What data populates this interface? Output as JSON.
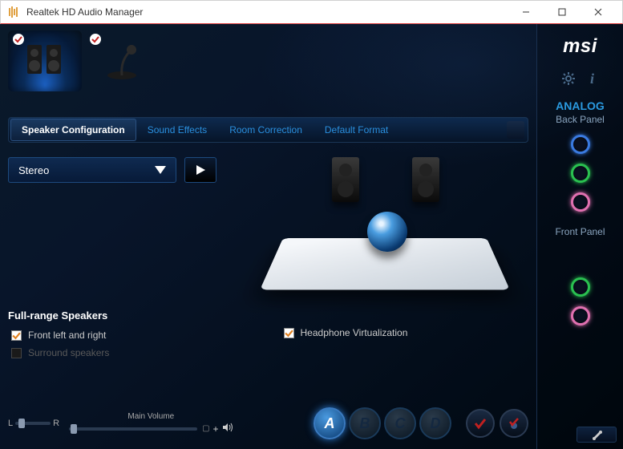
{
  "window": {
    "title": "Realtek HD Audio Manager"
  },
  "brand": "msi",
  "devices": {
    "speakers": {
      "checked": true,
      "active": true
    },
    "mic": {
      "checked": true,
      "active": false
    }
  },
  "tabs": {
    "speaker_config": "Speaker Configuration",
    "sound_effects": "Sound Effects",
    "room_correction": "Room Correction",
    "default_format": "Default Format",
    "active": "speaker_config"
  },
  "config": {
    "dropdown_value": "Stereo",
    "full_range_title": "Full-range Speakers",
    "front_lr": {
      "label": "Front left and right",
      "checked": true
    },
    "surround": {
      "label": "Surround speakers",
      "checked": false,
      "disabled": true
    },
    "headphone_virt": {
      "label": "Headphone Virtualization",
      "checked": true
    }
  },
  "footer": {
    "balance": {
      "L": "L",
      "R": "R"
    },
    "main_volume_label": "Main Volume",
    "presets": [
      "A",
      "B",
      "C",
      "D"
    ],
    "active_preset": 0
  },
  "side": {
    "analog": "ANALOG",
    "back_panel": "Back Panel",
    "front_panel": "Front Panel",
    "jacks_back": [
      "blue",
      "green",
      "pink"
    ],
    "jacks_front": [
      "green",
      "pink"
    ]
  }
}
